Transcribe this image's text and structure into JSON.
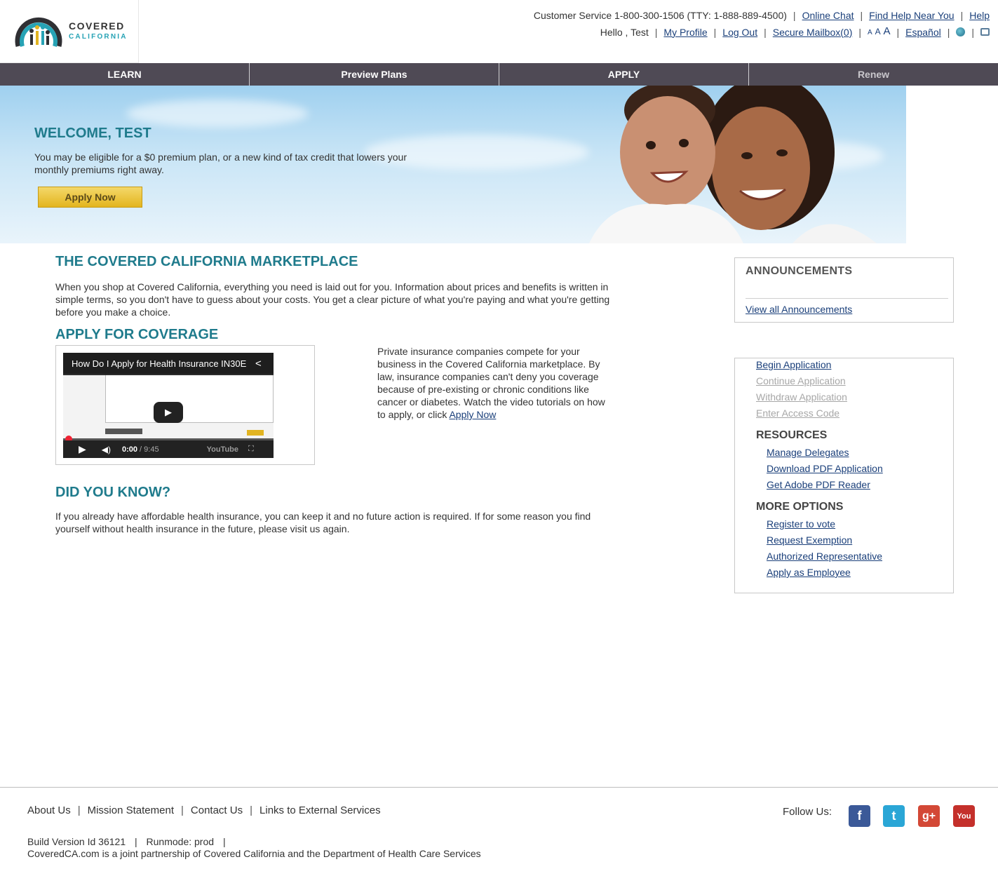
{
  "logo": {
    "line1": "COVERED",
    "line2": "CALIFORNIA"
  },
  "utility": {
    "customer_service": "Customer Service 1-800-300-1506 (TTY: 1-888-889-4500)",
    "online_chat": "Online Chat",
    "find_help": "Find Help Near You",
    "help": "Help",
    "greeting": "Hello , Test",
    "my_profile": "My Profile",
    "log_out": "Log Out",
    "secure_mailbox": "Secure Mailbox(0)",
    "size_small": "A",
    "size_medium": "A",
    "size_large": "A",
    "espanol": "Español"
  },
  "nav": [
    {
      "label": "LEARN"
    },
    {
      "label": "Preview Plans"
    },
    {
      "label": "APPLY"
    },
    {
      "label": "Renew"
    }
  ],
  "hero": {
    "title": "WELCOME, TEST",
    "text": "You may be eligible for a $0 premium plan, or a new kind of tax credit that lowers your monthly premiums right away.",
    "button": "Apply Now"
  },
  "main": {
    "marketplace_title": "THE COVERED CALIFORNIA MARKETPLACE",
    "marketplace_text": "When you shop at Covered California, everything you need is laid out for you. Information about prices and benefits is written in simple terms, so you don't have to guess about your costs. You get a clear picture of what you're paying and what you're getting before you make a choice.",
    "apply_title": "APPLY FOR COVERAGE",
    "video_title": "How Do I Apply for Health Insurance IN30E",
    "video_time": "0:00",
    "video_duration": "/ 9:45",
    "video_brand": "YouTube",
    "apply_text": "Private insurance companies compete for your business in the Covered California marketplace. By law, insurance companies can't deny you coverage because of pre-existing or chronic conditions like cancer or diabetes. Watch the video tutorials on how to apply, or click",
    "apply_link": "Apply Now",
    "know_title": "DID YOU KNOW?",
    "know_text": "If you already have affordable health insurance, you can keep it and no future action is required. If for some reason you find yourself without health insurance in the future, please visit us again."
  },
  "announcements": {
    "title": "ANNOUNCEMENTS",
    "link": "View all Announcements"
  },
  "sidebar": {
    "actions": [
      {
        "label": "Begin Application",
        "enabled": true
      },
      {
        "label": "Continue Application",
        "enabled": false
      },
      {
        "label": "Withdraw Application",
        "enabled": false
      },
      {
        "label": "Enter Access Code",
        "enabled": false
      }
    ],
    "resources_title": "RESOURCES",
    "resources": [
      "Manage Delegates",
      "Download PDF Application",
      "Get Adobe PDF Reader"
    ],
    "more_title": "MORE OPTIONS",
    "more": [
      "Register to vote",
      "Request Exemption",
      "Authorized Representative",
      "Apply as Employee"
    ]
  },
  "footer": {
    "links": [
      "About Us",
      "Mission Statement",
      "Contact Us",
      "Links to External Services"
    ],
    "build": "Build Version Id 36121",
    "runmode": "Runmode: prod",
    "partnership": "CoveredCA.com is a joint partnership of Covered California and the Department of Health Care Services",
    "follow": "Follow Us:",
    "social": [
      {
        "name": "facebook",
        "glyph": "f",
        "color": "#3b5998"
      },
      {
        "name": "twitter",
        "glyph": "t",
        "color": "#2aa6d6"
      },
      {
        "name": "google-plus",
        "glyph": "g+",
        "color": "#d34836"
      },
      {
        "name": "youtube",
        "glyph": "You",
        "color": "#c4302b"
      }
    ]
  }
}
